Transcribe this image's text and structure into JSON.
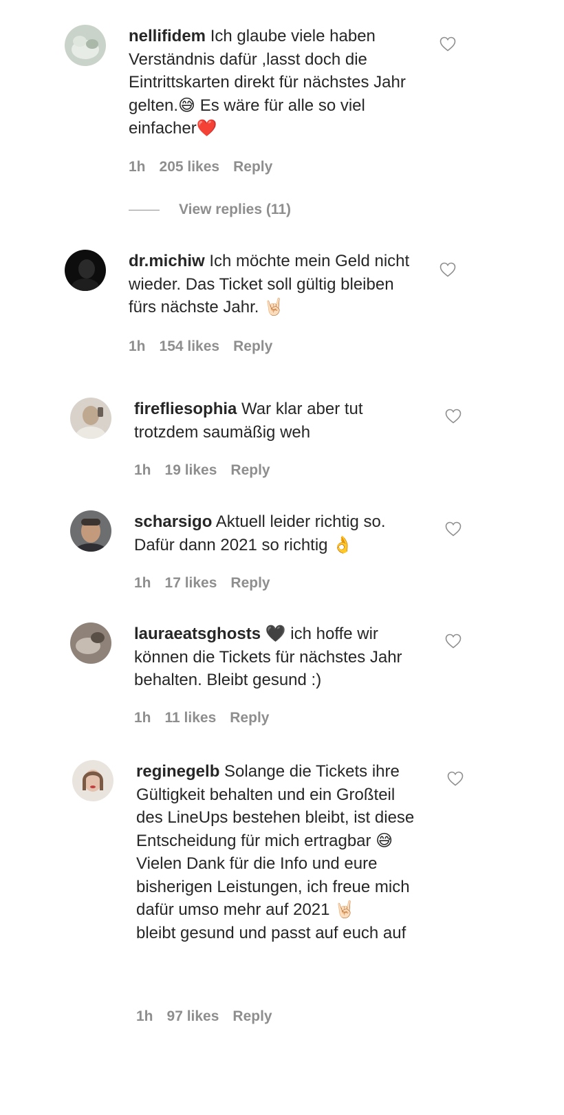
{
  "comments": [
    {
      "username": "nellifidem",
      "text": "Ich glaube viele haben Verständnis dafür ,lasst doch die Eintrittskarten direkt für nächstes Jahr gelten.😅 Es wäre für alle so viel einfacher❤️",
      "time": "1h",
      "likes": "205 likes",
      "reply": "Reply",
      "view_replies": "View replies (11)"
    },
    {
      "username": "dr.michiw",
      "text": "Ich möchte mein Geld nicht wieder. Das Ticket soll gültig bleiben fürs nächste Jahr. 🤘🏻",
      "time": "1h",
      "likes": "154 likes",
      "reply": "Reply"
    },
    {
      "username": "firefliesophia",
      "text": "War klar aber tut trotzdem saumäßig weh",
      "time": "1h",
      "likes": "19 likes",
      "reply": "Reply"
    },
    {
      "username": "scharsigo",
      "text": "Aktuell leider richtig so. Dafür dann 2021 so richtig 👌",
      "time": "1h",
      "likes": "17 likes",
      "reply": "Reply"
    },
    {
      "username": "lauraeatsghosts",
      "text": "🖤 ich hoffe wir können die Tickets für nächstes Jahr behalten. Bleibt gesund :)",
      "time": "1h",
      "likes": "11 likes",
      "reply": "Reply"
    },
    {
      "username": "reginegelb",
      "text": "Solange die Tickets ihre Gültigkeit behalten und ein Großteil des LineUps bestehen bleibt, ist diese Entscheidung für mich ertragbar 😅\nVielen Dank für die Info und eure bisherigen Leistungen, ich freue mich dafür umso mehr auf 2021 🤘🏻\nbleibt gesund und passt auf euch auf",
      "time": "1h",
      "likes": "97 likes",
      "reply": "Reply"
    }
  ],
  "colors": {
    "text": "#262626",
    "secondary": "#8e8e8e",
    "background": "#ffffff"
  }
}
